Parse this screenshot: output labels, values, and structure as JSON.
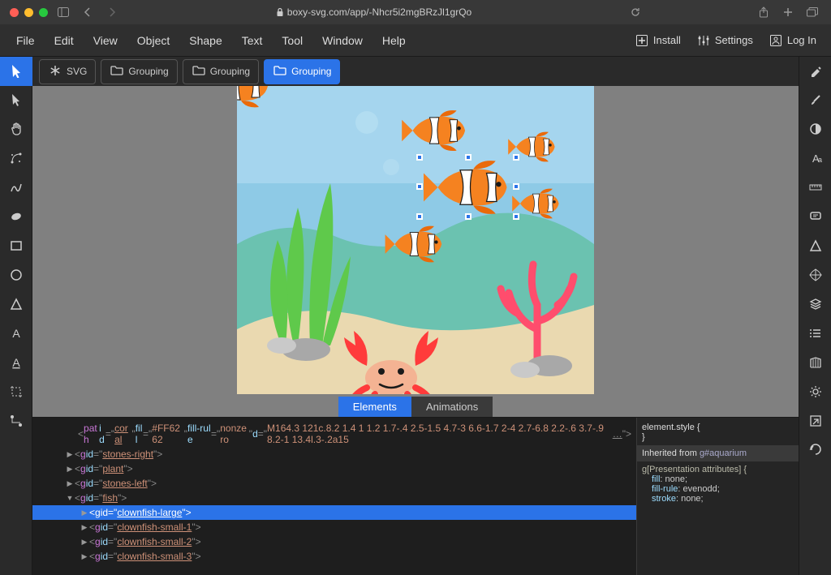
{
  "browser": {
    "url": "boxy-svg.com/app/-Nhcr5i2mgBRzJl1grQo"
  },
  "menubar": {
    "items": [
      "File",
      "Edit",
      "View",
      "Object",
      "Shape",
      "Text",
      "Tool",
      "Window",
      "Help"
    ],
    "install": "Install",
    "settings": "Settings",
    "login": "Log In"
  },
  "breadcrumbs": [
    {
      "label": "SVG",
      "icon": "asterisk",
      "active": false
    },
    {
      "label": "Grouping",
      "icon": "folder",
      "active": false
    },
    {
      "label": "Grouping",
      "icon": "folder",
      "active": false
    },
    {
      "label": "Grouping",
      "icon": "folder",
      "active": true
    }
  ],
  "left_tools": [
    {
      "name": "select-tool",
      "icon": "cursor",
      "active": true
    },
    {
      "name": "edit-tool",
      "icon": "cursor-edit"
    },
    {
      "name": "pan-tool",
      "icon": "hand"
    },
    {
      "name": "spline-tool",
      "icon": "spline"
    },
    {
      "name": "freehand-tool",
      "icon": "freehand"
    },
    {
      "name": "blob-tool",
      "icon": "blob"
    },
    {
      "name": "rect-tool",
      "icon": "rect"
    },
    {
      "name": "circle-tool",
      "icon": "circle"
    },
    {
      "name": "triangle-tool",
      "icon": "triangle"
    },
    {
      "name": "text-tool",
      "icon": "text"
    },
    {
      "name": "textpath-tool",
      "icon": "textpath"
    },
    {
      "name": "crop-tool",
      "icon": "crop"
    },
    {
      "name": "connector-tool",
      "icon": "connector"
    }
  ],
  "right_tools": [
    {
      "name": "fill-panel",
      "icon": "paint"
    },
    {
      "name": "stroke-panel",
      "icon": "brush"
    },
    {
      "name": "compositing-panel",
      "icon": "contrast"
    },
    {
      "name": "typography-panel",
      "icon": "typo"
    },
    {
      "name": "geometry-panel",
      "icon": "ruler"
    },
    {
      "name": "meta-panel",
      "icon": "comment"
    },
    {
      "name": "shape-panel",
      "icon": "shape-tri"
    },
    {
      "name": "arrange-panel",
      "icon": "arrange"
    },
    {
      "name": "layers-panel",
      "icon": "layers"
    },
    {
      "name": "objects-panel",
      "icon": "list"
    },
    {
      "name": "library-panel",
      "icon": "library"
    },
    {
      "name": "generators-panel",
      "icon": "gear"
    },
    {
      "name": "export-panel",
      "icon": "export"
    },
    {
      "name": "history-panel",
      "icon": "undo"
    }
  ],
  "bottom_tabs": {
    "elements": "Elements",
    "animations": "Animations"
  },
  "elements": {
    "path_line": "<path id=\"coral\" fill=\"#FF6262\" fill-rule=\"nonzero\" d=\"M164.3 121c.8.2 1.4 1 1.2 1.7-.4 2.5-1.5 4.7-3 6.6-1.7 2-4 2.7-6.8 2.2-.6 3.7-.9 8.2-1 13.4l.3-.2a15 ...\">",
    "groups": [
      {
        "id": "stones-right",
        "expanded": false,
        "indent": 0
      },
      {
        "id": "plant",
        "expanded": false,
        "indent": 0
      },
      {
        "id": "stones-left",
        "expanded": false,
        "indent": 0
      },
      {
        "id": "fish",
        "expanded": true,
        "indent": 0
      },
      {
        "id": "clownfish-large",
        "expanded": false,
        "indent": 1,
        "selected": true
      },
      {
        "id": "clownfish-small-1",
        "expanded": false,
        "indent": 1
      },
      {
        "id": "clownfish-small-2",
        "expanded": false,
        "indent": 1
      },
      {
        "id": "clownfish-small-3",
        "expanded": false,
        "indent": 1
      }
    ]
  },
  "styles": {
    "element_style": "element.style {",
    "brace_close": "}",
    "inherited_label": "Inherited from",
    "inherited_from": "g#aquarium",
    "selector": "g[Presentation attributes] {",
    "props": [
      {
        "name": "fill",
        "value": "none;"
      },
      {
        "name": "fill-rule",
        "value": "evenodd;"
      },
      {
        "name": "stroke",
        "value": "none;"
      }
    ]
  }
}
